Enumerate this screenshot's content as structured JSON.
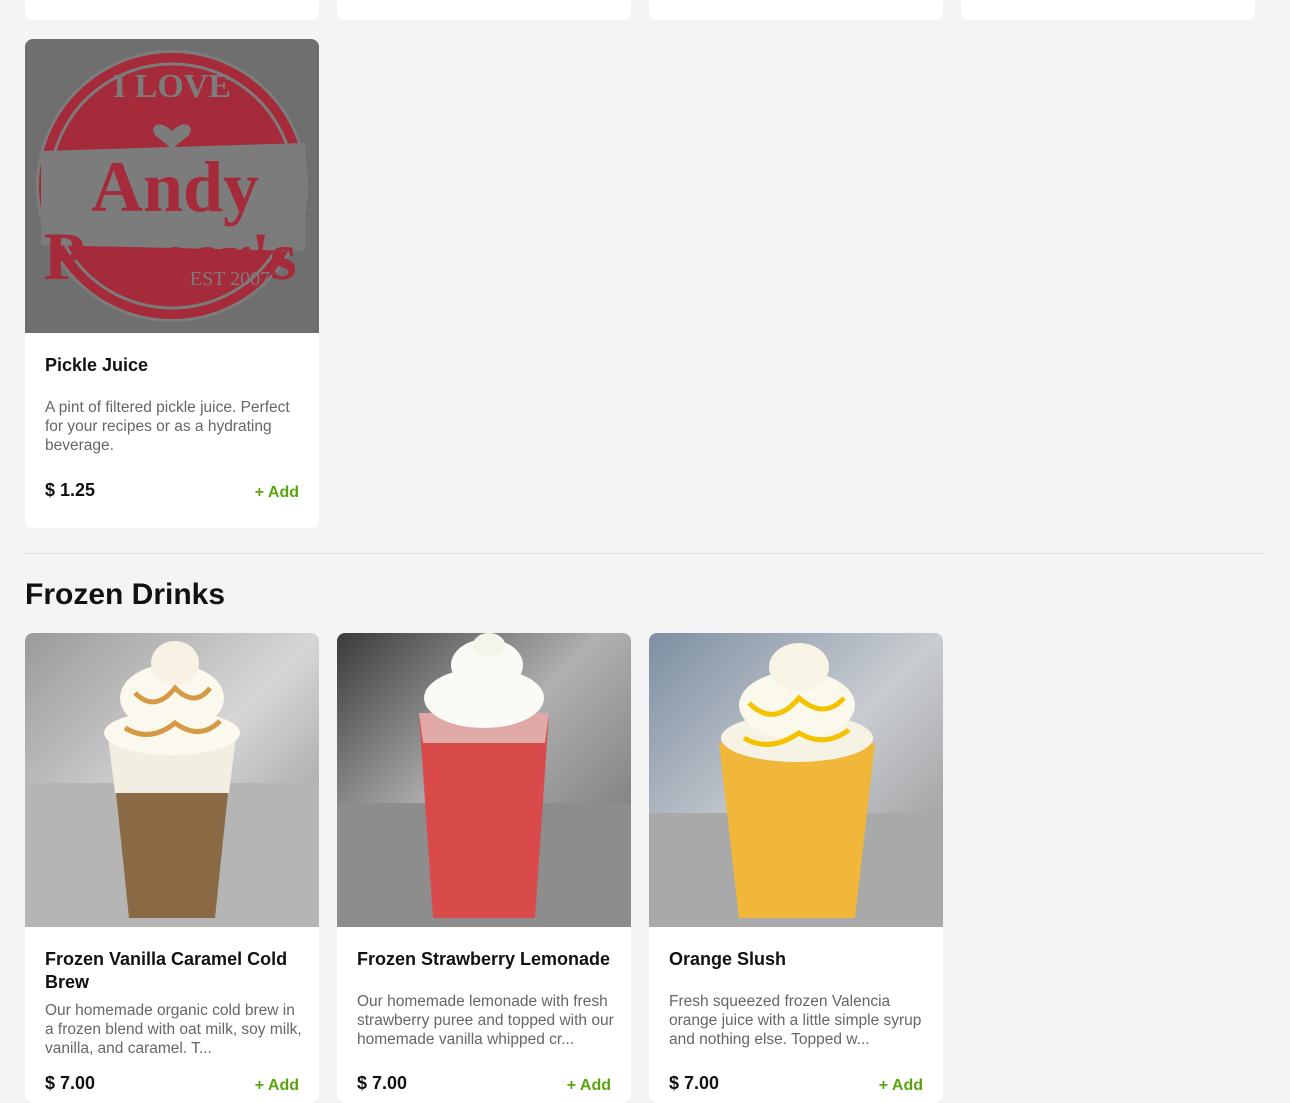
{
  "pickle_section": {
    "items": [
      {
        "title": "Pickle Juice",
        "description": "A pint of filtered pickle juice. Perfect for your recipes or as a hydrating beverage.",
        "price": "$ 1.25",
        "add_label": "+ Add",
        "logo": {
          "top_text": "I LOVE",
          "name_line1": "Andy",
          "name_line2": "Pepper's",
          "est": "EST 2007"
        }
      }
    ]
  },
  "frozen_section": {
    "title": "Frozen Drinks",
    "items": [
      {
        "title": "Frozen Vanilla Caramel Cold Brew",
        "description": "Our homemade organic cold brew in a frozen blend with oat milk, soy milk, vanilla, and caramel. T...",
        "price": "$ 7.00",
        "add_label": "+ Add"
      },
      {
        "title": "Frozen Strawberry Lemonade",
        "description": "Our homemade lemonade with fresh strawberry puree and topped with our homemade vanilla whipped cr...",
        "price": "$ 7.00",
        "add_label": "+ Add"
      },
      {
        "title": "Orange Slush",
        "description": "Fresh squeezed frozen Valencia orange juice with a little simple syrup and nothing else. Topped w...",
        "price": "$ 7.00",
        "add_label": "+ Add"
      }
    ]
  },
  "colors": {
    "background": "#f4f4f4",
    "add_green": "#5aa40f",
    "logo_red": "#a52a3a"
  }
}
